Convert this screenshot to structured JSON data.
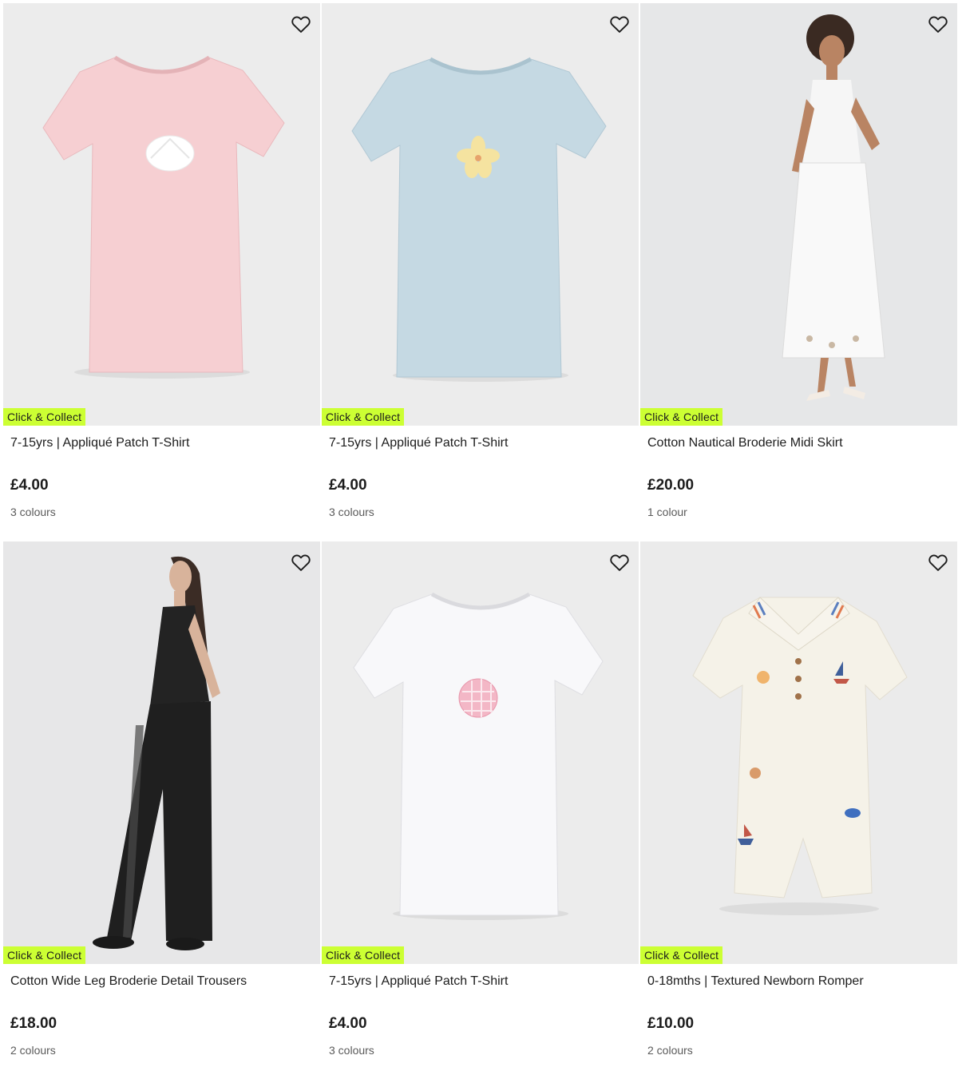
{
  "products": [
    {
      "badge": "Click & Collect",
      "title": "7-15yrs | Appliqué Patch T-Shirt",
      "price": "£4.00",
      "colours": "3 colours",
      "image": "pink t-shirt with shell patch"
    },
    {
      "badge": "Click & Collect",
      "title": "7-15yrs | Appliqué Patch T-Shirt",
      "price": "£4.00",
      "colours": "3 colours",
      "image": "blue t-shirt with flower patch"
    },
    {
      "badge": "Click & Collect",
      "title": "Cotton Nautical Broderie Midi Skirt",
      "price": "£20.00",
      "colours": "1 colour",
      "image": "model in white midi skirt"
    },
    {
      "badge": "Click & Collect",
      "title": "Cotton Wide Leg Broderie Detail Trousers",
      "price": "£18.00",
      "colours": "2 colours",
      "image": "model in black wide leg trousers"
    },
    {
      "badge": "Click & Collect",
      "title": "7-15yrs | Appliqué Patch T-Shirt",
      "price": "£4.00",
      "colours": "3 colours",
      "image": "white t-shirt with gingham patch"
    },
    {
      "badge": "Click & Collect",
      "title": "0-18mths | Textured Newborn Romper",
      "price": "£10.00",
      "colours": "2 colours",
      "image": "cream textured romper"
    }
  ],
  "icons": {
    "wishlist": "heart-outline-icon"
  },
  "colors": {
    "badge_bg": "#ccff33",
    "image_bg": "#ededed"
  }
}
